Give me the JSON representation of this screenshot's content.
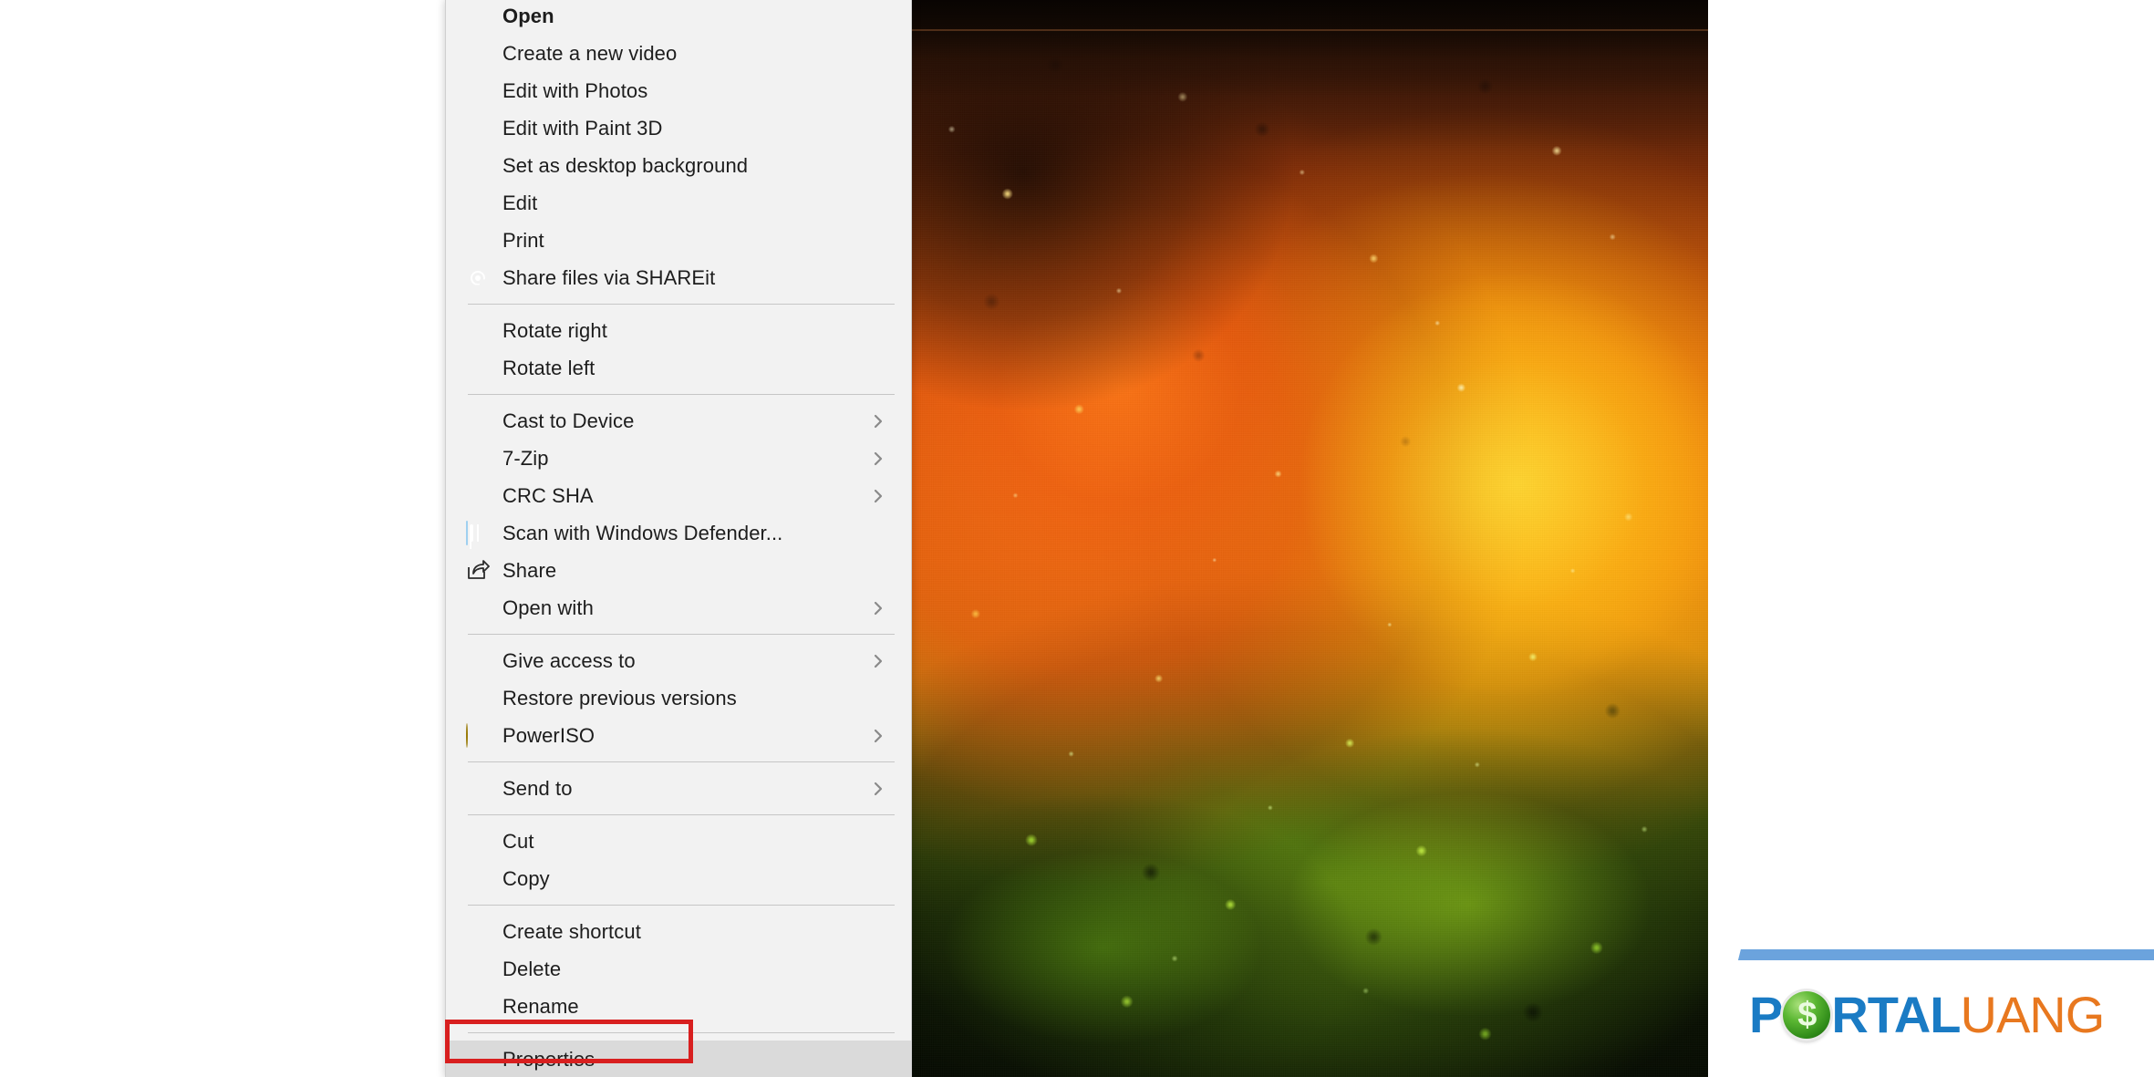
{
  "window": {
    "background_color": "#ffffff"
  },
  "photo": {
    "name": "colored-powder-explosion-photo",
    "description": "Colored powder explosion photograph",
    "palette": {
      "top_dark": "#170a04",
      "orange": "#ef7a10",
      "yellow": "#ffbe14",
      "green": "#78aa14",
      "bottom_dark": "#060a02"
    }
  },
  "context_menu": {
    "name": "file-context-menu",
    "background_color": "#f2f2f2",
    "highlight_color": "#dadada",
    "separator_color": "#c6c6c6",
    "items": [
      {
        "label": "Open",
        "bold": true,
        "icon": null,
        "submenu": false,
        "separator_after": false
      },
      {
        "label": "Create a new video",
        "bold": false,
        "icon": null,
        "submenu": false,
        "separator_after": false
      },
      {
        "label": "Edit with Photos",
        "bold": false,
        "icon": null,
        "submenu": false,
        "separator_after": false
      },
      {
        "label": "Edit with Paint 3D",
        "bold": false,
        "icon": null,
        "submenu": false,
        "separator_after": false
      },
      {
        "label": "Set as desktop background",
        "bold": false,
        "icon": null,
        "submenu": false,
        "separator_after": false
      },
      {
        "label": "Edit",
        "bold": false,
        "icon": null,
        "submenu": false,
        "separator_after": false
      },
      {
        "label": "Print",
        "bold": false,
        "icon": null,
        "submenu": false,
        "separator_after": false
      },
      {
        "label": "Share files via SHAREit",
        "bold": false,
        "icon": "shareit-icon",
        "submenu": false,
        "separator_after": true
      },
      {
        "label": "Rotate right",
        "bold": false,
        "icon": null,
        "submenu": false,
        "separator_after": false
      },
      {
        "label": "Rotate left",
        "bold": false,
        "icon": null,
        "submenu": false,
        "separator_after": true
      },
      {
        "label": "Cast to Device",
        "bold": false,
        "icon": null,
        "submenu": true,
        "separator_after": false
      },
      {
        "label": "7-Zip",
        "bold": false,
        "icon": null,
        "submenu": true,
        "separator_after": false
      },
      {
        "label": "CRC SHA",
        "bold": false,
        "icon": null,
        "submenu": true,
        "separator_after": false
      },
      {
        "label": "Scan with Windows Defender...",
        "bold": false,
        "icon": "windows-defender-icon",
        "submenu": false,
        "separator_after": false
      },
      {
        "label": "Share",
        "bold": false,
        "icon": "share-icon",
        "submenu": false,
        "separator_after": false
      },
      {
        "label": "Open with",
        "bold": false,
        "icon": null,
        "submenu": true,
        "separator_after": true
      },
      {
        "label": "Give access to",
        "bold": false,
        "icon": null,
        "submenu": true,
        "separator_after": false
      },
      {
        "label": "Restore previous versions",
        "bold": false,
        "icon": null,
        "submenu": false,
        "separator_after": false
      },
      {
        "label": "PowerISO",
        "bold": false,
        "icon": "poweriso-icon",
        "submenu": true,
        "separator_after": true
      },
      {
        "label": "Send to",
        "bold": false,
        "icon": null,
        "submenu": true,
        "separator_after": true
      },
      {
        "label": "Cut",
        "bold": false,
        "icon": null,
        "submenu": false,
        "separator_after": false
      },
      {
        "label": "Copy",
        "bold": false,
        "icon": null,
        "submenu": false,
        "separator_after": true
      },
      {
        "label": "Create shortcut",
        "bold": false,
        "icon": null,
        "submenu": false,
        "separator_after": false
      },
      {
        "label": "Delete",
        "bold": false,
        "icon": null,
        "submenu": false,
        "separator_after": false
      },
      {
        "label": "Rename",
        "bold": false,
        "icon": null,
        "submenu": false,
        "separator_after": true
      },
      {
        "label": "Properties",
        "bold": false,
        "icon": null,
        "submenu": false,
        "separator_after": false,
        "highlighted": true
      }
    ]
  },
  "annotation": {
    "name": "properties-highlight-box",
    "target_label": "Properties",
    "color": "#d81f1f",
    "shape": "rectangle"
  },
  "watermark": {
    "brand_part_1": "P",
    "brand_coin_glyph": "$",
    "brand_part_2": "RTAL",
    "brand_part_3": "UANG",
    "blue": "#1a7bc4",
    "orange": "#e8781f",
    "bar_color": "#6ba3dd",
    "coin_green": "#5bb733"
  }
}
